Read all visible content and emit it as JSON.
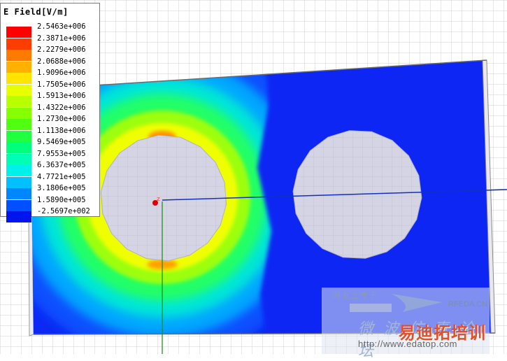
{
  "legend": {
    "title": "E Field[V/m]",
    "entries": [
      {
        "value": "2.5463e+006",
        "color": "#ff0000"
      },
      {
        "value": "2.3871e+006",
        "color": "#ff3d00"
      },
      {
        "value": "2.2279e+006",
        "color": "#ff7a00"
      },
      {
        "value": "2.0688e+006",
        "color": "#ffb000"
      },
      {
        "value": "1.9096e+006",
        "color": "#ffe400"
      },
      {
        "value": "1.7505e+006",
        "color": "#e8ff00"
      },
      {
        "value": "1.5913e+006",
        "color": "#b8ff00"
      },
      {
        "value": "1.4322e+006",
        "color": "#86ff00"
      },
      {
        "value": "1.2730e+006",
        "color": "#50ff10"
      },
      {
        "value": "1.1138e+006",
        "color": "#20ff40"
      },
      {
        "value": "9.5469e+005",
        "color": "#00ff7a"
      },
      {
        "value": "7.9553e+005",
        "color": "#00ffb4"
      },
      {
        "value": "6.3637e+005",
        "color": "#00f0ea"
      },
      {
        "value": "4.7721e+005",
        "color": "#00c0ff"
      },
      {
        "value": "3.1806e+005",
        "color": "#0086ff"
      },
      {
        "value": "1.5890e+005",
        "color": "#0050ff"
      },
      {
        "value": "-2.5697e+002",
        "color": "#0014f0"
      }
    ]
  },
  "colors": {
    "field_low": "#0b28f4",
    "conductor": "#d4d4e4",
    "axis_x": "#1030c8",
    "axis_y": "#138a13",
    "origin_marker": "#d80000",
    "grid": "#d0d0d0"
  },
  "axis_label": "z",
  "watermark": {
    "line1": "网友上传于",
    "logo_text": "RFEDA.CN",
    "line2": "微波仿真论坛",
    "brand": "易迪拓培训",
    "url": "http://www.edatop.com"
  }
}
